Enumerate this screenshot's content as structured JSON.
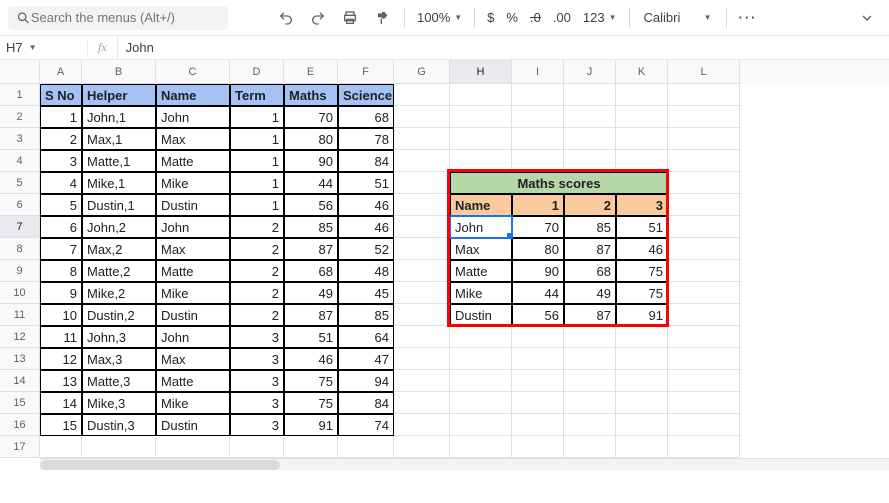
{
  "toolbar": {
    "search_placeholder": "Search the menus (Alt+/)",
    "zoom": "100%",
    "currency": "$",
    "percent": "%",
    "dec_minus": ".0",
    "dec_plus": ".00",
    "more_fmt": "123",
    "font": "Calibri"
  },
  "formula_bar": {
    "cell_ref": "H7",
    "fx": "fx",
    "content": "John"
  },
  "columns": [
    "A",
    "B",
    "C",
    "D",
    "E",
    "F",
    "G",
    "H",
    "I",
    "J",
    "K",
    "L"
  ],
  "selected_col": "H",
  "selected_row": 7,
  "main_headers": [
    "S No",
    "Helper",
    "Name",
    "Term",
    "Maths",
    "Science"
  ],
  "main_rows": [
    {
      "s": 1,
      "h": "John,1",
      "n": "John",
      "t": 1,
      "m": 70,
      "sc": 68
    },
    {
      "s": 2,
      "h": "Max,1",
      "n": "Max",
      "t": 1,
      "m": 80,
      "sc": 78
    },
    {
      "s": 3,
      "h": "Matte,1",
      "n": "Matte",
      "t": 1,
      "m": 90,
      "sc": 84
    },
    {
      "s": 4,
      "h": "Mike,1",
      "n": "Mike",
      "t": 1,
      "m": 44,
      "sc": 51
    },
    {
      "s": 5,
      "h": "Dustin,1",
      "n": "Dustin",
      "t": 1,
      "m": 56,
      "sc": 46
    },
    {
      "s": 6,
      "h": "John,2",
      "n": "John",
      "t": 2,
      "m": 85,
      "sc": 46
    },
    {
      "s": 7,
      "h": "Max,2",
      "n": "Max",
      "t": 2,
      "m": 87,
      "sc": 52
    },
    {
      "s": 8,
      "h": "Matte,2",
      "n": "Matte",
      "t": 2,
      "m": 68,
      "sc": 48
    },
    {
      "s": 9,
      "h": "Mike,2",
      "n": "Mike",
      "t": 2,
      "m": 49,
      "sc": 45
    },
    {
      "s": 10,
      "h": "Dustin,2",
      "n": "Dustin",
      "t": 2,
      "m": 87,
      "sc": 85
    },
    {
      "s": 11,
      "h": "John,3",
      "n": "John",
      "t": 3,
      "m": 51,
      "sc": 64
    },
    {
      "s": 12,
      "h": "Max,3",
      "n": "Max",
      "t": 3,
      "m": 46,
      "sc": 47
    },
    {
      "s": 13,
      "h": "Matte,3",
      "n": "Matte",
      "t": 3,
      "m": 75,
      "sc": 94
    },
    {
      "s": 14,
      "h": "Mike,3",
      "n": "Mike",
      "t": 3,
      "m": 75,
      "sc": 84
    },
    {
      "s": 15,
      "h": "Dustin,3",
      "n": "Dustin",
      "t": 3,
      "m": 91,
      "sc": 74
    }
  ],
  "pivot": {
    "title": "Maths scores",
    "col_name": "Name",
    "cols": [
      1,
      2,
      3
    ],
    "rows": [
      {
        "n": "John",
        "v": [
          70,
          85,
          51
        ]
      },
      {
        "n": "Max",
        "v": [
          80,
          87,
          46
        ]
      },
      {
        "n": "Matte",
        "v": [
          90,
          68,
          75
        ]
      },
      {
        "n": "Mike",
        "v": [
          44,
          49,
          75
        ]
      },
      {
        "n": "Dustin",
        "v": [
          56,
          87,
          91
        ]
      }
    ]
  },
  "chart_data": {
    "type": "table",
    "title": "Maths scores",
    "categories": [
      "John",
      "Max",
      "Matte",
      "Mike",
      "Dustin"
    ],
    "series": [
      {
        "name": "1",
        "values": [
          70,
          80,
          90,
          44,
          56
        ]
      },
      {
        "name": "2",
        "values": [
          85,
          87,
          68,
          49,
          87
        ]
      },
      {
        "name": "3",
        "values": [
          51,
          46,
          75,
          75,
          91
        ]
      }
    ]
  }
}
